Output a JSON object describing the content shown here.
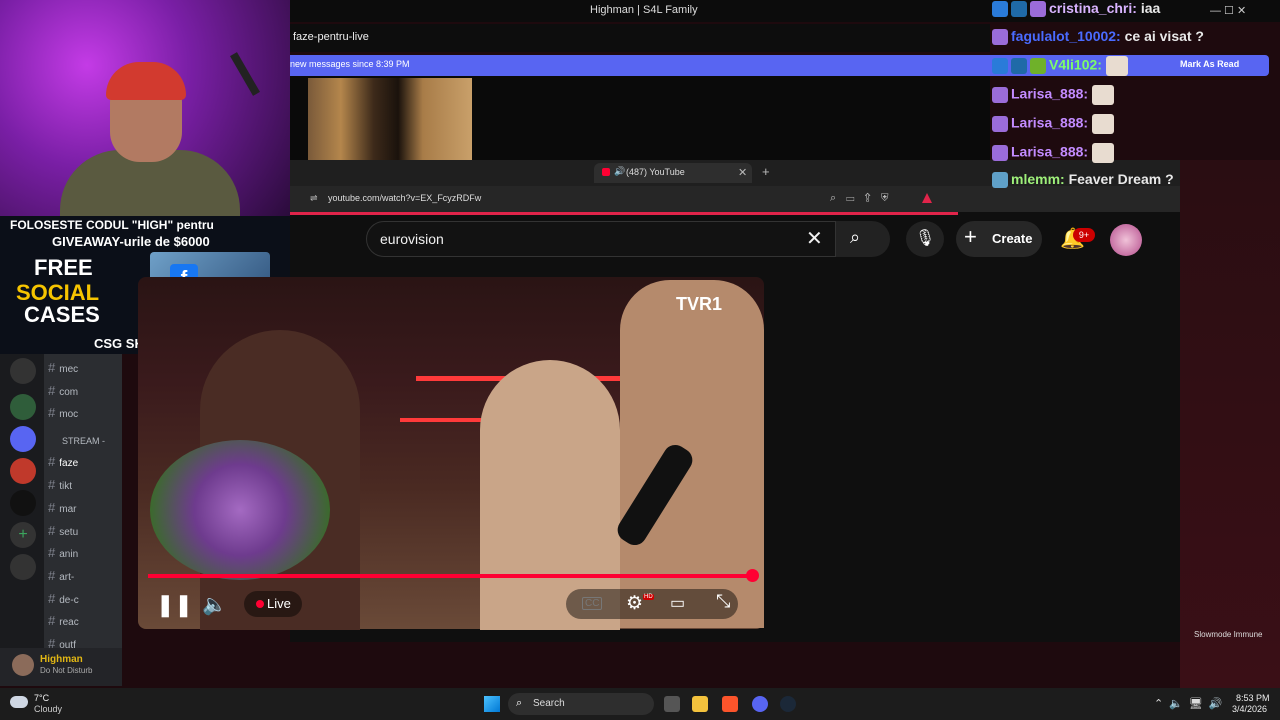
{
  "window": {
    "title": "Highman | S4L Family",
    "controls": "—   ☐   ✕"
  },
  "discord": {
    "channel": "faze-pentru-live",
    "banner_text": "new messages since 8:39 PM",
    "mark_read": "Mark As Read",
    "channels": [
      {
        "name": "mec"
      },
      {
        "name": "com"
      },
      {
        "name": "moc"
      },
      {
        "name": "faze"
      },
      {
        "name": "tikt"
      },
      {
        "name": "mar"
      },
      {
        "name": "setu"
      },
      {
        "name": "anin"
      },
      {
        "name": "art-"
      },
      {
        "name": "de-c"
      },
      {
        "name": "reac"
      },
      {
        "name": "outf"
      }
    ],
    "category": "STREAM -",
    "user": {
      "name": "Highman",
      "status": "Do Not Disturb"
    },
    "slowmode": "Slowmode Immune"
  },
  "sponsor": {
    "line1": "FOLOSESTE CODUL \"HIGH\" pentru",
    "line2": "GIVEAWAY-urile de $6000",
    "free": "FREE",
    "social": "SOCIAL",
    "cases": "CASES",
    "brand": "CSG SKINS",
    "fb_icon": "f"
  },
  "browser": {
    "tab_label": "(487) YouTube",
    "url": "youtube.com/watch?v=EX_FcyzRDFw",
    "new_tab": "+",
    "tab_close": "✕"
  },
  "youtube": {
    "search_value": "eurovision",
    "create_label": "Create",
    "notif_count": "9+",
    "live_label": "Live",
    "hd_badge": "HD",
    "cc_label": "CC",
    "channel_logo": "TVR1",
    "progress": 1.0
  },
  "chat": [
    {
      "user": "cristina_chri:",
      "msg": "iaa",
      "color": "#d9b4ff"
    },
    {
      "user": "fagulalot_10002:",
      "msg": "ce ai visat ?",
      "color": "#4a6bff"
    },
    {
      "user": "V4li102:",
      "msg": "",
      "color": "#7cfc6a"
    },
    {
      "user": "Larisa_888:",
      "msg": "",
      "color": "#c38bff"
    },
    {
      "user": "Larisa_888:",
      "msg": "",
      "color": "#c38bff"
    },
    {
      "user": "Larisa_888:",
      "msg": "",
      "color": "#c38bff"
    },
    {
      "user": "mlemm:",
      "msg": "Feaver Dream ?",
      "color": "#9ef07a"
    }
  ],
  "taskbar": {
    "weather_temp": "7°C",
    "weather_desc": "Cloudy",
    "search": "Search",
    "time": "8:53 PM",
    "date": "3/4/2026"
  }
}
